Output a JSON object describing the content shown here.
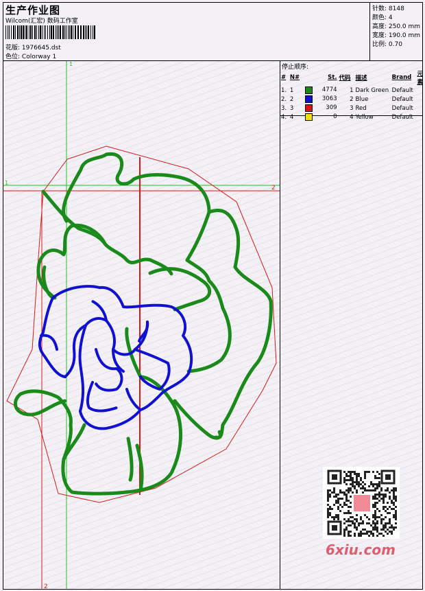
{
  "header": {
    "title": "生产作业图",
    "studio": "Wilcom(汇宏) 数码工作室",
    "file_label": "花版:",
    "file_name": "1976645.dst",
    "colorway_label": "色位:",
    "colorway_name": "Colorway 1"
  },
  "stats": {
    "stitches": "针数: 8148",
    "colors": "颜色: 4",
    "height": "高度: 250.0 mm",
    "width": "宽度: 190.0 mm",
    "scale": "比例: 0.70"
  },
  "stop_sequence": {
    "title": "停止顺序:",
    "columns": [
      "#",
      "N#",
      "St.",
      "代码",
      "描述",
      "Brand",
      "元素"
    ],
    "rows": [
      {
        "idx": "1.",
        "n": "1",
        "color": "#1a8a1a",
        "st": "4774",
        "code": "1",
        "desc": "Dark Green",
        "brand": "Default"
      },
      {
        "idx": "2.",
        "n": "2",
        "color": "#1010d0",
        "st": "3063",
        "code": "2",
        "desc": "Blue",
        "brand": "Default"
      },
      {
        "idx": "3.",
        "n": "3",
        "color": "#e01010",
        "st": "309",
        "code": "3",
        "desc": "Red",
        "brand": "Default"
      },
      {
        "idx": "4.",
        "n": "4",
        "color": "#f0e000",
        "st": "0",
        "code": "4",
        "desc": "Yellow",
        "brand": "Default"
      }
    ]
  },
  "guides": {
    "green_v_label": "1",
    "green_h_label": "1",
    "red_h_label": "2",
    "red_v_label": "2"
  },
  "watermark": "6xiu.com",
  "colors": {
    "green_guide": "#22c322",
    "red_guide": "#d81818",
    "green_thread": "#1a8a1a",
    "blue_thread": "#1010d0",
    "red_thread": "#e01010"
  }
}
